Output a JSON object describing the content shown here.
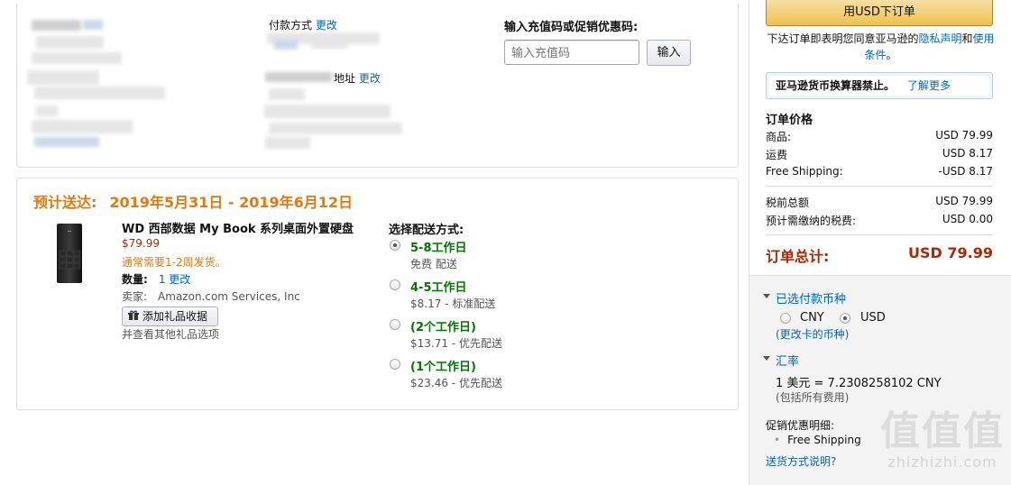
{
  "address": {
    "change_label": "更改"
  },
  "payment": {
    "title": "付款方式",
    "change_label": "更改",
    "billing_title": "地址",
    "billing_change": "更改"
  },
  "giftcard": {
    "title": "输入充值码或促销优惠码:",
    "placeholder": "输入充值码",
    "button": "输入"
  },
  "shipment": {
    "arrival_label": "预计送达:",
    "arrival_dates": "2019年5月31日 - 2019年6月12日",
    "product": {
      "title": "WD 西部数据 My Book 系列桌面外置硬盘",
      "price": "$79.99",
      "availability": "通常需要1-2周发货。",
      "qty_label": "数量:",
      "qty_value": "1",
      "qty_change": "更改",
      "seller_label": "卖家:",
      "seller_name": "Amazon.com Services, Inc",
      "gift_button": "添加礼品收据",
      "gift_more": "并查看其他礼品选项"
    },
    "options_title": "选择配送方式:",
    "options": [
      {
        "main": "5-8工作日",
        "sub": "免费 配送",
        "selected": true
      },
      {
        "main": "4-5工作日",
        "sub": "$8.17 - 标准配送",
        "selected": false
      },
      {
        "main": "(2个工作日)",
        "sub": "$13.71 - 优先配送",
        "selected": false
      },
      {
        "main": "(1个工作日)",
        "sub": "$23.46 - 优先配送",
        "selected": false
      }
    ]
  },
  "sidebar": {
    "place_order": "用USD下订单",
    "agree_prefix": "下达订单即表明您同意亚马逊的",
    "privacy_link": "隐私声明",
    "and": "和",
    "terms_link": "使用条件",
    "period": "。",
    "converter_notice": "亚马逊货币换算器禁止。",
    "learn_more": "了解更多",
    "summary_title": "订单价格",
    "rows": [
      {
        "label": "商品:",
        "value": "USD 79.99"
      },
      {
        "label": "运费",
        "value": "USD 8.17"
      },
      {
        "label": "Free Shipping:",
        "value": "-USD 8.17"
      },
      {
        "label": "税前总额",
        "value": "USD 79.99"
      },
      {
        "label": "预计需缴纳的税费:",
        "value": "USD 0.00"
      }
    ],
    "total_label": "订单总计:",
    "total_value": "USD 79.99",
    "currency_section": "已选付款币种",
    "currency_cny": "CNY",
    "currency_usd": "USD",
    "change_card_currency": "(更改卡的币种)",
    "rate_section": "汇率",
    "rate_value": "1 美元 = 7.2308258102 CNY",
    "rate_note": "(包括所有费用)",
    "promo_title": "促销优惠明细:",
    "promo_item": "Free Shipping",
    "shipping_explain": "送货方式说明?"
  },
  "watermark": {
    "big": "值值值",
    "small": "zhizhizhi.com"
  }
}
